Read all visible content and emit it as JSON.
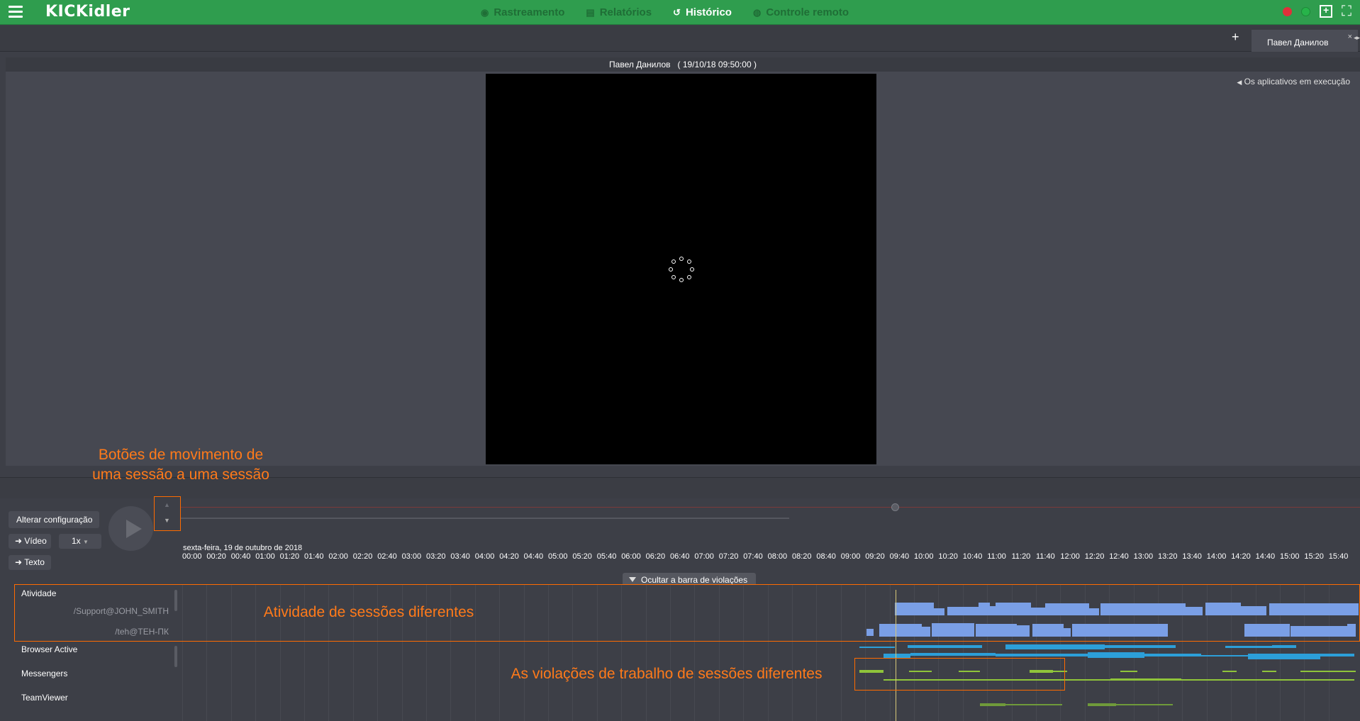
{
  "app": {
    "logo": "KICKidler"
  },
  "nav": [
    {
      "label": "Rastreamento",
      "icon": "eye-icon",
      "active": false
    },
    {
      "label": "Relatórios",
      "icon": "document-icon",
      "active": false
    },
    {
      "label": "Histórico",
      "icon": "history-icon",
      "active": true
    },
    {
      "label": "Controle remoto",
      "icon": "remote-icon",
      "active": false
    }
  ],
  "tabs": {
    "add": "+",
    "active_tab": "Павел Данилов",
    "close": "×",
    "arrows": "◂▸"
  },
  "player": {
    "header_name": "Павел Данилов",
    "header_datetime": "( 19/10/18 09:50:00 )",
    "apps_link": "Os aplicativos em execução"
  },
  "controls": {
    "config_button": "Alterar configuração",
    "video_button": "Vídeo",
    "speed": "1x",
    "text_button": "Texto"
  },
  "timeline": {
    "date": "sexta-feira, 19 de outubro de 2018",
    "ticks": [
      "00:00",
      "00:20",
      "00:40",
      "01:00",
      "01:20",
      "01:40",
      "02:00",
      "02:20",
      "02:40",
      "03:00",
      "03:20",
      "03:40",
      "04:00",
      "04:20",
      "04:40",
      "05:00",
      "05:20",
      "05:40",
      "06:00",
      "06:20",
      "06:40",
      "07:00",
      "07:20",
      "07:40",
      "08:00",
      "08:20",
      "08:40",
      "09:00",
      "09:20",
      "09:40",
      "10:00",
      "10:20",
      "10:40",
      "11:00",
      "11:20",
      "11:40",
      "12:00",
      "12:20",
      "12:40",
      "13:00",
      "13:20",
      "13:40",
      "14:00",
      "14:20",
      "14:40",
      "15:00",
      "15:20",
      "15:40"
    ],
    "hide_violations": "Ocultar a barra de violações",
    "rows": {
      "activity": "Atividade",
      "session1": "/Support@JOHN_SMITH",
      "session2": "/teh@TEH-ПК",
      "browser": "Browser Active",
      "messengers": "Messengers",
      "teamviewer": "TeamViewer"
    }
  },
  "annotations": {
    "session_buttons": "Botões de movimento de\numa sessão a uma sessão",
    "activity": "Atividade de sessões diferentes",
    "violations": "As violações de trabalho de sessões diferentes"
  },
  "colors": {
    "accent_green": "#2f9d4e",
    "annotation_orange": "#ff6b00",
    "activity_blue": "#7a9fe6",
    "browser_blue": "#2c9fd9",
    "messenger_green": "#8fc43a"
  }
}
